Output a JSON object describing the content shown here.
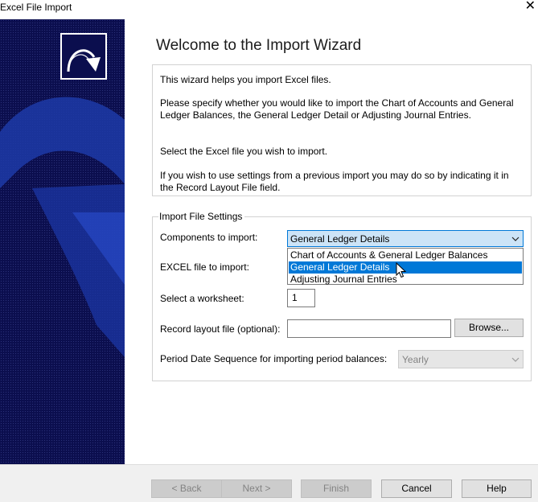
{
  "window": {
    "title": "Excel File Import",
    "close_glyph": "✕"
  },
  "wizard": {
    "heading": "Welcome to the Import Wizard",
    "info": {
      "p1": "This wizard helps you import Excel files.",
      "p2": "Please specify whether you would like to import the Chart of Accounts and General Ledger Balances, the General Ledger Detail or Adjusting Journal Entries.",
      "p3": "Select the Excel file you wish to import.",
      "p4": "If you wish to use settings from a previous import you may do so by indicating it in the Record Layout File field."
    }
  },
  "settings": {
    "legend": "Import File Settings",
    "components_label": "Components to import:",
    "components_value": "General Ledger Details",
    "components_options": [
      "Chart of Accounts & General Ledger Balances",
      "General Ledger Details",
      "Adjusting Journal Entries"
    ],
    "excel_label": "EXCEL file to import:",
    "worksheet_label": "Select a worksheet:",
    "worksheet_value": "1",
    "record_layout_label": "Record layout file (optional):",
    "record_layout_value": "",
    "browse_label": "Browse...",
    "period_label": "Period Date Sequence for importing period balances:",
    "period_value": "Yearly"
  },
  "footer": {
    "back_label": "< Back",
    "next_label": "Next >",
    "finish_label": "Finish",
    "cancel_label": "Cancel",
    "help_label": "Help"
  },
  "colors": {
    "side_panel": "#0b0e4e",
    "selection": "#0078d7",
    "combo_focus": "#cce4f7"
  }
}
